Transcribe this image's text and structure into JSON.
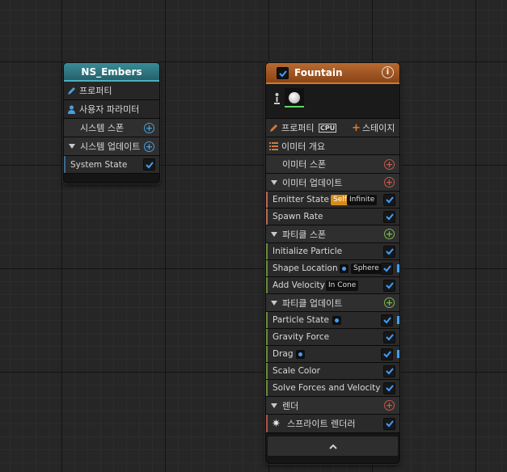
{
  "colors": {
    "ns_header": "#2b6f7a",
    "fountain_header": "#a45a25",
    "checkbox_accent": "#3ea0ff",
    "emitter_bar": "#b86a52",
    "particle_bar": "#6a8a3a",
    "render_bar": "#b0504a",
    "system_bar": "#3a6a8a",
    "self_badge": "#d98a19"
  },
  "ns_node": {
    "title": "NS_Embers",
    "rows": [
      {
        "label": "프로퍼티",
        "icon": "pencil-icon"
      },
      {
        "label": "사용자 파라미터",
        "icon": "user-icon"
      },
      {
        "label": "시스템 스폰",
        "icon": "plus-circle-icon"
      },
      {
        "label": "시스템 업데이트",
        "icon": "plus-circle-icon"
      }
    ],
    "module": {
      "label": "System State",
      "checked": true
    }
  },
  "fountain_node": {
    "title": "Fountain",
    "title_checked": true,
    "info_icon": "info-icon",
    "properties_label": "프로퍼티",
    "cpu_label": "CPU",
    "stage_label": "스테이지",
    "summary_label": "이미터 개요",
    "emitter_spawn_label": "이미터 스폰",
    "emitter_update": {
      "label": "이미터 업데이트",
      "modules": [
        {
          "label": "Emitter State",
          "badges": [
            "Self",
            "Infinite"
          ],
          "checked": true
        },
        {
          "label": "Spawn Rate",
          "checked": true
        }
      ]
    },
    "particle_spawn": {
      "label": "파티클 스폰",
      "modules": [
        {
          "label": "Initialize Particle",
          "checked": true
        },
        {
          "label": "Shape Location",
          "badges": [
            "Sphere"
          ],
          "checked": true
        },
        {
          "label": "Add Velocity",
          "badges": [
            "In Cone"
          ],
          "checked": true
        }
      ]
    },
    "particle_update": {
      "label": "파티클 업데이트",
      "modules": [
        {
          "label": "Particle State",
          "checked": true
        },
        {
          "label": "Gravity Force",
          "checked": true
        },
        {
          "label": "Drag",
          "checked": true
        },
        {
          "label": "Scale Color",
          "checked": true
        },
        {
          "label": "Solve Forces and Velocity",
          "checked": true
        }
      ]
    },
    "render": {
      "label": "렌더",
      "modules": [
        {
          "label": "스프라이트 렌더러",
          "checked": true
        }
      ]
    }
  }
}
